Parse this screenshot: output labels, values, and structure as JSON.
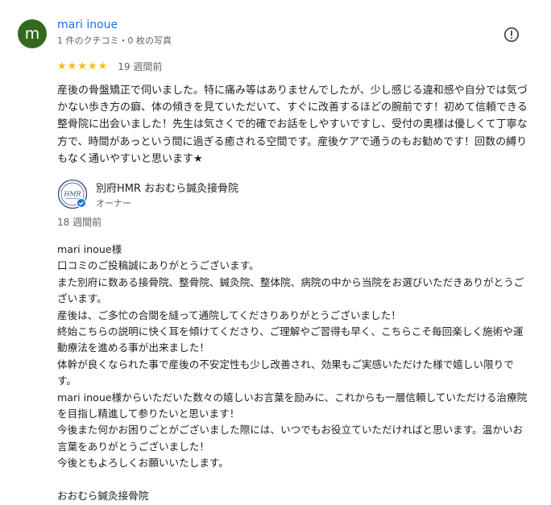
{
  "review": {
    "avatar_letter": "m",
    "avatar_color": "#33691e",
    "author_name": "mari inoue",
    "author_meta": "1 件のクチコミ・0 枚の写真",
    "report_icon": "report-flag-icon",
    "rating_stars": "★★★★★",
    "rating_value": 5,
    "time": "19 週間前",
    "text": "産後の骨盤矯正で伺いました。特に痛み等はありませんでしたが、少し感じる違和感や自分では気づかない歩き方の癖、体の傾きを見ていただいて、すぐに改善するほどの腕前です！初めて信頼できる整骨院に出会いました！先生は気さくで的確でお話をしやすいですし、受付の奥様は優しくて丁寧な方で、時間があっという間に過ぎる癒される空間です。産後ケアで通うのもお勧めです！回数の縛りもなく通いやすいと思います★"
  },
  "owner_response": {
    "logo_icon": "hmr-logo-icon",
    "logo_text": "HMR",
    "verified_icon": "verified-check-icon",
    "owner_name": "別府HMR おおむら鍼灸接骨院",
    "owner_role": "オーナー",
    "time": "18 週間前",
    "text": "mari inoue様\n口コミのご投稿誠にありがとうございます。\nまた別府に数ある接骨院、整骨院、鍼灸院、整体院、病院の中から当院をお選びいただきありがとうございます。\n産後は、ご多忙の合間を縫って通院してくださりありがとうございました！\n終始こちらの説明に快く耳を傾けてくださり、ご理解やご習得も早く、こちらこそ毎回楽しく施術や運動療法を進める事が出来ました！\n体幹が良くなられた事で産後の不安定性も少し改善され、効果もご実感いただけた様で嬉しい限りです。\nmari inoue様からいただいた数々の嬉しいお言葉を励みに、これからも一層信頼していただける治療院を目指し精進して参りたいと思います！\n今後また何かお困りごとがございました際には、いつでもお役立ていただければと思います。温かいお言葉をありがとうございました！\n今後ともよろしくお願いいたします。\n\nおおむら鍼灸接骨院"
  }
}
